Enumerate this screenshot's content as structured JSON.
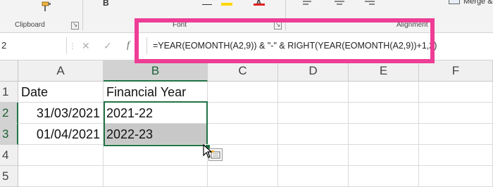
{
  "ribbon": {
    "groups": {
      "clipboard": "Clipboard",
      "font": "Font",
      "alignment": "Alignment"
    },
    "merge_label": "Merge &",
    "bold_glyph": "B",
    "font_color_glyph": "A",
    "icons": [
      "format-painter-icon",
      "bold-icon",
      "underline-icon",
      "highlight-icon",
      "font-color-icon",
      "align-icon",
      "merge-icon"
    ]
  },
  "formula_bar": {
    "name_box": "2",
    "cancel_glyph": "✕",
    "enter_glyph": "✓",
    "fx_glyph": "f",
    "formula": "=YEAR(EOMONTH(A2,9)) & \"-\" & RIGHT(YEAR(EOMONTH(A2,9))+1,2)"
  },
  "grid": {
    "columns": [
      "A",
      "B",
      "C",
      "D",
      "E",
      "F"
    ],
    "rows": [
      "1",
      "2",
      "3",
      "4",
      "5"
    ],
    "cells": {
      "a1": "Date",
      "b1": "Financial Year",
      "a2": "31/03/2021",
      "b2": "2021-22",
      "a3": "01/04/2021",
      "b3": "2022-23"
    }
  },
  "colors": {
    "excel_green": "#217346",
    "highlight_pink": "#ee3d95",
    "font_color_red": "#e02020",
    "highlight_yellow": "#ffd700"
  }
}
